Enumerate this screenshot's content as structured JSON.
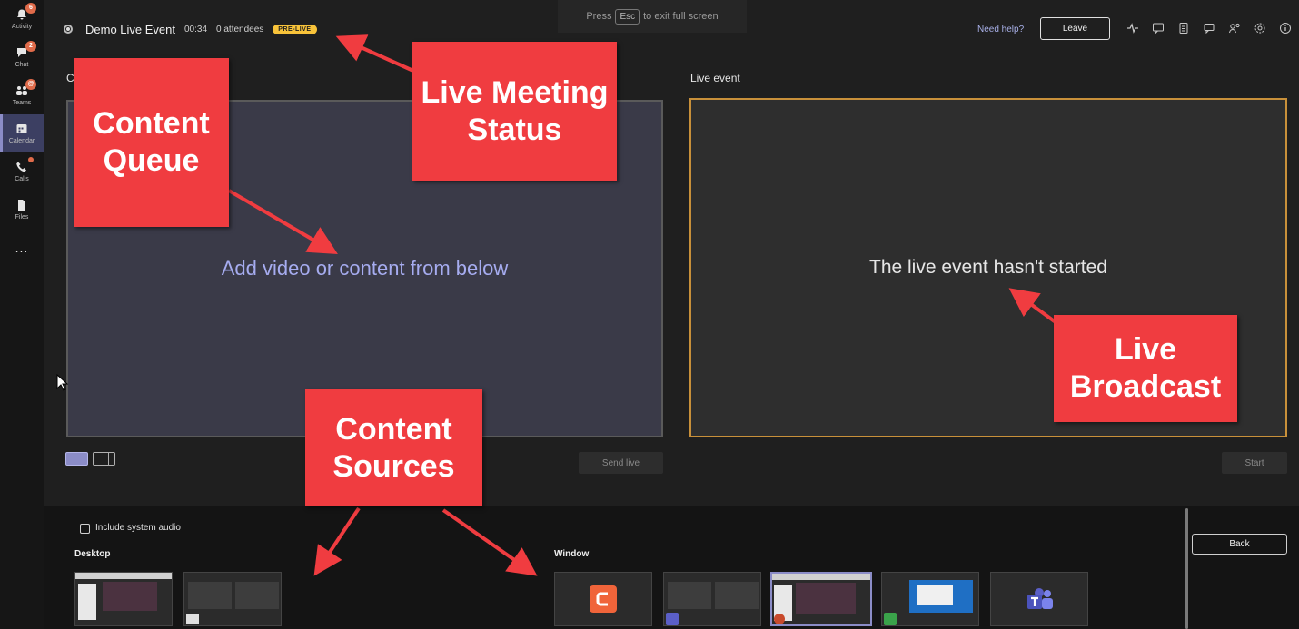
{
  "rail": {
    "items": [
      {
        "label": "Activity",
        "badge": "6"
      },
      {
        "label": "Chat",
        "badge": "2"
      },
      {
        "label": "Teams",
        "badge": "@"
      },
      {
        "label": "Calendar"
      },
      {
        "label": "Calls"
      },
      {
        "label": "Files"
      }
    ],
    "more": "..."
  },
  "event": {
    "title": "Demo Live Event",
    "timer": "00:34",
    "attendees": "0 attendees",
    "status": "PRE-LIVE"
  },
  "esc": {
    "press": "Press",
    "key": "Esc",
    "suffix": "to exit full screen"
  },
  "header": {
    "help": "Need help?",
    "leave": "Leave"
  },
  "queue": {
    "label_partial": "C",
    "placeholder": "Add video or content from below",
    "send_live": "Send live"
  },
  "live": {
    "label": "Live event",
    "message": "The live event hasn't started",
    "start": "Start"
  },
  "tray": {
    "include_audio": "Include system audio",
    "desktop_heading": "Desktop",
    "window_heading": "Window",
    "back": "Back"
  },
  "annotations": {
    "content_queue": "Content Queue",
    "live_status": "Live Meeting Status",
    "live_broadcast": "Live Broadcast",
    "content_sources": "Content Sources"
  },
  "colors": {
    "accent": "#8b8cc7",
    "prelive": "#f8c33a",
    "live_border": "#c8903a",
    "callout": "#f03c40"
  }
}
